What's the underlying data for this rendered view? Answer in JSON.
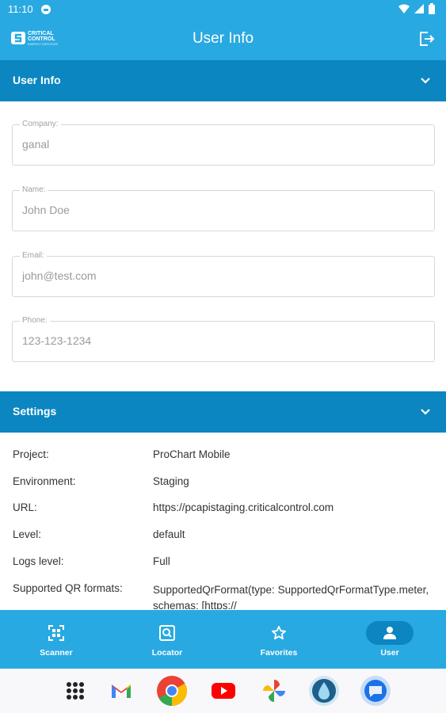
{
  "status_bar": {
    "time": "11:10"
  },
  "app_bar": {
    "title": "User Info",
    "logo_line1": "CRITICAL",
    "logo_line2": "CONTROL",
    "logo_tagline": "ENERGY SERVICES"
  },
  "user_info_section": {
    "title": "User Info",
    "fields": [
      {
        "label": "Company:",
        "value": "ganal"
      },
      {
        "label": "Name:",
        "value": "John Doe"
      },
      {
        "label": "Email:",
        "value": "john@test.com"
      },
      {
        "label": "Phone:",
        "value": "123-123-1234"
      }
    ]
  },
  "settings_section": {
    "title": "Settings",
    "rows": [
      {
        "label": "Project:",
        "value": "ProChart Mobile"
      },
      {
        "label": "Environment:",
        "value": "Staging"
      },
      {
        "label": "URL:",
        "value": "https://pcapistaging.criticalcontrol.com"
      },
      {
        "label": "Level:",
        "value": "default"
      },
      {
        "label": "Logs level:",
        "value": "Full"
      },
      {
        "label": "Supported QR formats:",
        "value": "SupportedQrFormat(type: SupportedQrFormatType.meter, schemas: [https://"
      }
    ]
  },
  "bottom_nav": {
    "items": [
      {
        "label": "Scanner",
        "icon": "qr-scanner-icon"
      },
      {
        "label": "Locator",
        "icon": "locator-icon"
      },
      {
        "label": "Favorites",
        "icon": "star-icon"
      },
      {
        "label": "User",
        "icon": "person-icon"
      }
    ],
    "active": "User"
  },
  "dock": {
    "apps": [
      "app-drawer",
      "gmail",
      "chrome",
      "youtube",
      "photos",
      "prochart",
      "messages"
    ]
  },
  "colors": {
    "primary": "#29a9e1",
    "primary_dark": "#0b86c1"
  }
}
